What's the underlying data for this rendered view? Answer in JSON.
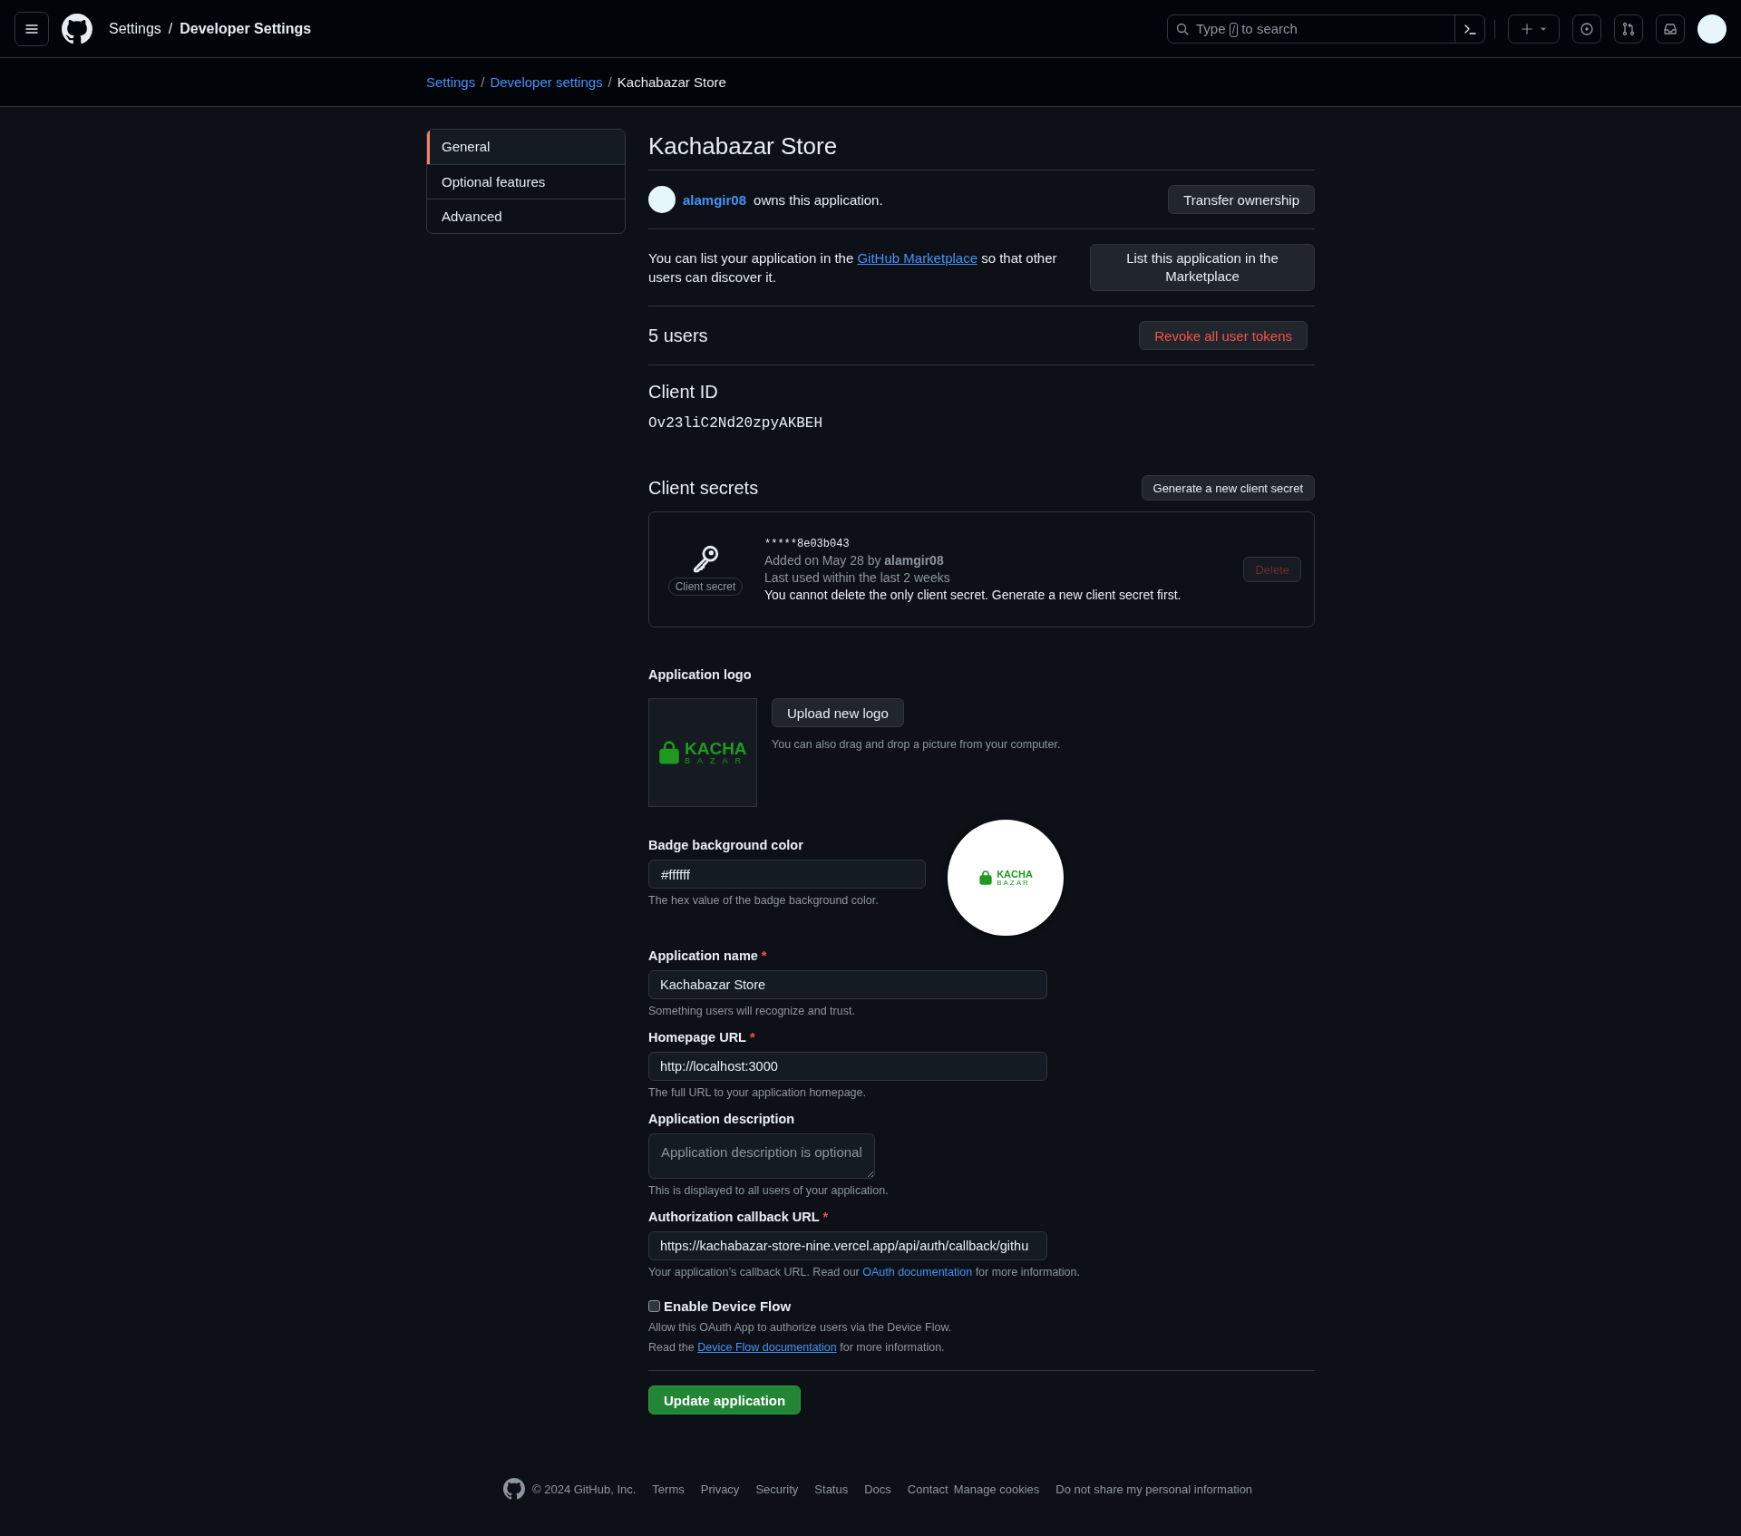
{
  "header": {
    "title": [
      {
        "kind": "plain",
        "text": "Settings"
      },
      {
        "kind": "separator",
        "text": "/"
      },
      {
        "kind": "strong",
        "text": "Developer Settings"
      }
    ],
    "search": {
      "before": "Type",
      "key": "/",
      "after": "to search"
    }
  },
  "breadcrumbs": [
    {
      "kind": "link",
      "text": "Settings"
    },
    {
      "kind": "separator",
      "text": "/"
    },
    {
      "kind": "link",
      "text": "Developer settings"
    },
    {
      "kind": "separator",
      "text": "/"
    },
    {
      "kind": "current",
      "text": "Kachabazar Store"
    }
  ],
  "sidebar": {
    "items": [
      {
        "label": "General",
        "selected": true
      },
      {
        "label": "Optional features",
        "selected": false
      },
      {
        "label": "Advanced",
        "selected": false
      }
    ]
  },
  "app": {
    "title": "Kachabazar Store",
    "owner": {
      "user": "alamgir08",
      "text": " owns this application.",
      "button": "Transfer ownership"
    },
    "marketplace": {
      "before": "You can list your application in the ",
      "link": "GitHub Marketplace",
      "after": " so that other users can discover it.",
      "button": "List this application in the Marketplace"
    },
    "users": {
      "heading": "5 users",
      "button": "Revoke all user tokens"
    },
    "client_id": {
      "heading": "Client ID",
      "value": "Ov23liC2Nd20zpyAKBEH"
    },
    "client_secrets": {
      "heading": "Client secrets",
      "button": "Generate a new client secret",
      "secrets": [
        {
          "badge": "Client secret",
          "value": "*****8e03b043",
          "added": "Added on May 28 by **alamgir08**",
          "last_used": "Last used within the last 2 weeks",
          "note": "You cannot delete the only client secret. Generate a new client secret first.",
          "delete": "Delete",
          "disabled": true
        }
      ]
    },
    "logo": {
      "label": "Application logo",
      "wordmark": "KACHA",
      "subline": "BAZAR",
      "button": "Upload new logo",
      "hint": "You can also drag and drop a picture from your computer."
    },
    "badge": {
      "label": "Badge background color",
      "value": "#ffffff",
      "hint": "The hex value of the badge background color.",
      "wordmark": "KACHA",
      "subline": "BAZAR"
    },
    "fields": [
      {
        "kind": "input",
        "label": "Application name",
        "required_mark": "*",
        "value": "Kachabazar Store",
        "hint": "Something users will recognize and trust."
      },
      {
        "kind": "input",
        "label": "Homepage URL",
        "required_mark": "*",
        "value": "http://localhost:3000",
        "hint": "The full URL to your application homepage."
      },
      {
        "kind": "textarea",
        "label": "Application description",
        "placeholder": "Application description is optional",
        "hint": "This is displayed to all users of your application."
      },
      {
        "kind": "input",
        "label": "Authorization callback URL",
        "required_mark": "*",
        "value": "https://kachabazar-store-nine.vercel.app/api/auth/callback/githu",
        "hint": "Your application’s callback URL. Read our ",
        "hint_link": "OAuth documentation",
        "hint_after": " for more information."
      }
    ],
    "device_flow": {
      "label": "Enable Device Flow",
      "checked": false,
      "description": "Allow this OAuth App to authorize users via the Device Flow.",
      "before": "Read the ",
      "link": "Device Flow documentation",
      "after": " for more information."
    },
    "submit": "Update application"
  },
  "footer": {
    "copyright": "© 2024 GitHub, Inc.",
    "links": [
      "Terms",
      "Privacy",
      "Security",
      "Status",
      "Docs",
      "Contact",
      "Manage cookies",
      "Do not share my personal information"
    ]
  }
}
